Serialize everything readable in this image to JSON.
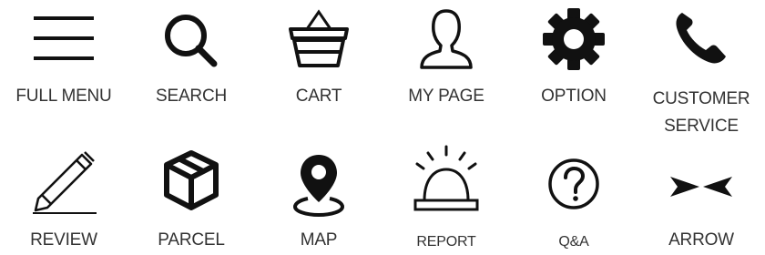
{
  "icons": [
    {
      "name": "full-menu-icon",
      "label": "FULL MENU"
    },
    {
      "name": "search-icon",
      "label": "SEARCH"
    },
    {
      "name": "cart-icon",
      "label": "CART"
    },
    {
      "name": "my-page-icon",
      "label": "MY PAGE"
    },
    {
      "name": "option-gear-icon",
      "label": "OPTION"
    },
    {
      "name": "phone-icon",
      "label": "CUSTOMER SERVICE"
    },
    {
      "name": "pencil-icon",
      "label": "REVIEW"
    },
    {
      "name": "box-icon",
      "label": "PARCEL"
    },
    {
      "name": "map-pin-icon",
      "label": "MAP"
    },
    {
      "name": "alarm-bell-icon",
      "label": "REPORT"
    },
    {
      "name": "question-circle-icon",
      "label": "Q&A"
    },
    {
      "name": "arrows-icon",
      "label": "ARROW"
    }
  ]
}
